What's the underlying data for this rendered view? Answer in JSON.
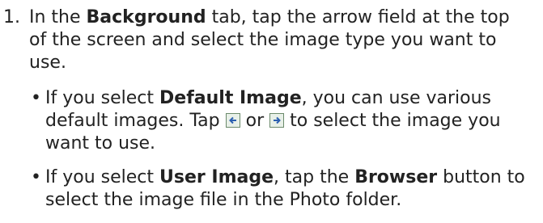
{
  "step": {
    "number": "1.",
    "text_a": "In the ",
    "text_b": "Background",
    "text_c": " tab, tap the arrow field at the top of the screen and select the image type you want to use."
  },
  "bullets": [
    {
      "marker": "•",
      "a": "If you select ",
      "b": "Default Image",
      "c": ", you can use various default images. Tap ",
      "d": " or ",
      "e": " to select the image you want to use."
    },
    {
      "marker": "•",
      "a": "If you select ",
      "b": "User Image",
      "c": ", tap the ",
      "d": "Browser",
      "e": " button to select the image file in the Photo folder."
    }
  ],
  "icons": {
    "prev": "left-arrow-button-icon",
    "next": "right-arrow-button-icon",
    "icon_color": "#2b5fb0"
  }
}
